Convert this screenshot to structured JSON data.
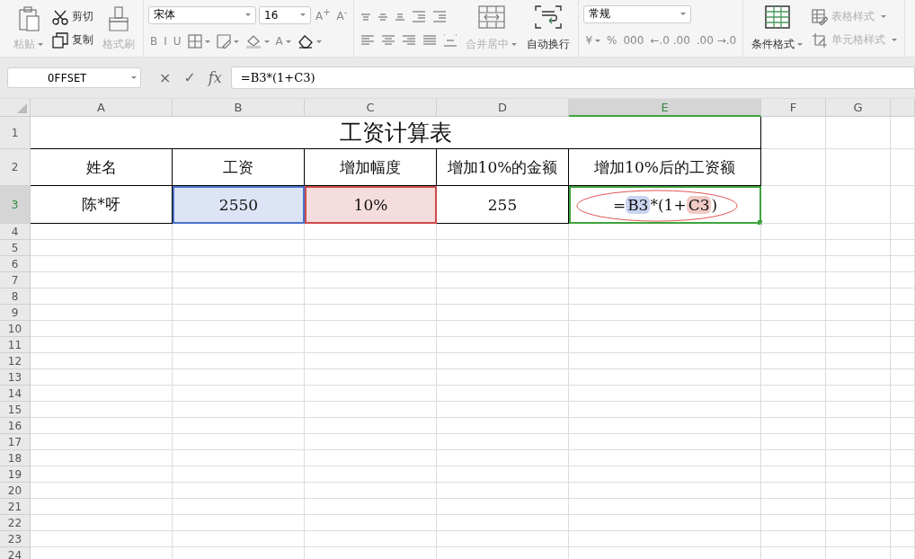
{
  "ribbon": {
    "groups": [
      {
        "kind": "row",
        "items": [
          {
            "kind": "big",
            "label": "粘贴",
            "disabled": true,
            "dropdown": true
          },
          {
            "kind": "col",
            "items": [
              {
                "kind": "small",
                "label": "剪切",
                "disabled": false
              },
              {
                "kind": "small",
                "label": "复制",
                "disabled": false
              }
            ]
          },
          {
            "kind": "big",
            "label": "格式刷",
            "disabled": true,
            "dropdown": false
          }
        ]
      },
      {
        "kind": "col",
        "items": [
          {
            "kind": "row",
            "items": [
              {
                "kind": "select",
                "value": "宋体"
              },
              {
                "kind": "select",
                "value": "16"
              },
              {
                "kind": "char",
                "label": "A$^{+}$",
                "dropdown": false
              },
              {
                "kind": "char",
                "label": "A$^{-}$",
                "dropdown": false
              }
            ]
          },
          {
            "kind": "row",
            "items": [
              {
                "kind": "char",
                "label": "B",
                "dropdown": false
              },
              {
                "kind": "char",
                "label": "I",
                "dropdown": false
              },
              {
                "kind": "char",
                "label": "U",
                "dropdown": false
              },
              {
                "kind": "icon",
                "dropdown": true
              },
              {
                "kind": "icon",
                "dropdown": true
              },
              {
                "kind": "icon",
                "dropdown": true
              },
              {
                "kind": "char",
                "label": "A",
                "dropdown": true
              },
              {
                "kind": "icon",
                "dropdown": true
              }
            ]
          }
        ]
      },
      {
        "kind": "row",
        "items": [
          {
            "kind": "col",
            "items": [
              {
                "kind": "row",
                "items": [
                  {
                    "kind": "icon",
                    "dropdown": false
                  },
                  {
                    "kind": "icon",
                    "dropdown": false
                  },
                  {
                    "kind": "icon",
                    "dropdown": false
                  },
                  {
                    "kind": "icon",
                    "dropdown": false
                  },
                  {
                    "kind": "icon",
                    "dropdown": false
                  }
                ]
              },
              {
                "kind": "row",
                "items": [
                  {
                    "kind": "icon",
                    "dropdown": false
                  },
                  {
                    "kind": "icon",
                    "dropdown": false
                  },
                  {
                    "kind": "icon",
                    "dropdown": false
                  },
                  {
                    "kind": "icon",
                    "dropdown": false
                  },
                  {
                    "kind": "icon",
                    "dropdown": false
                  }
                ]
              }
            ]
          },
          {
            "kind": "big",
            "label": "合并居中",
            "disabled": true,
            "dropdown": true
          },
          {
            "kind": "big",
            "label": "自动换行",
            "disabled": false,
            "dropdown": false
          }
        ]
      },
      {
        "kind": "col",
        "items": [
          {
            "kind": "row",
            "items": [
              {
                "kind": "select",
                "value": "常规"
              }
            ]
          },
          {
            "kind": "row",
            "items": [
              {
                "kind": "char",
                "label": "¥",
                "dropdown": true
              },
              {
                "kind": "char",
                "label": "%",
                "dropdown": false
              },
              {
                "kind": "char",
                "label": "000",
                "dropdown": false
              },
              {
                "kind": "char",
                "label": "←.0 .00",
                "dropdown": false
              },
              {
                "kind": "char",
                "label": ".00 →.0",
                "dropdown": false
              }
            ]
          }
        ]
      },
      {
        "kind": "row",
        "items": [
          {
            "kind": "big",
            "label": "条件格式",
            "disabled": false,
            "dropdown": true
          },
          {
            "kind": "col",
            "items": [
              {
                "kind": "small",
                "label": "表格样式",
                "disabled": true,
                "dropdown": true
              },
              {
                "kind": "small",
                "label": "单元格样式",
                "disabled": true,
                "dropdown": true
              }
            ]
          }
        ]
      }
    ]
  },
  "formula_bar": {
    "name_box": "OFFSET",
    "cancel": "×",
    "confirm": "✓",
    "fx": "fx",
    "formula": "=B3*(1+C3)"
  },
  "sheet": {
    "columns": [
      {
        "label": "A",
        "selected": false
      },
      {
        "label": "B",
        "selected": false
      },
      {
        "label": "C",
        "selected": false
      },
      {
        "label": "D",
        "selected": false
      },
      {
        "label": "E",
        "selected": true
      },
      {
        "label": "F",
        "selected": false
      },
      {
        "label": "G",
        "selected": false
      }
    ],
    "rows": [
      {
        "label": "1",
        "selected": false,
        "cells": [
          {
            "text": "工资计算表",
            "merged": true
          }
        ]
      },
      {
        "label": "2",
        "selected": false,
        "cells": [
          {
            "text": "姓名"
          },
          {
            "text": "工资"
          },
          {
            "text": "增加幅度"
          },
          {
            "text": "增加10%的金额"
          },
          {
            "text": "增加10%后的工资额"
          }
        ]
      },
      {
        "label": "3",
        "selected": true,
        "cells": [
          {
            "text": "陈*呀"
          },
          {
            "text": "2550",
            "color": "#4a72cc"
          },
          {
            "text": "10%",
            "color": "#cc4a4a"
          },
          {
            "text": "255"
          },
          {
            "selected": true,
            "parts": [
              {
                "kind": "plain",
                "text": "="
              },
              {
                "kind": "ref",
                "text": "B3",
                "color": "#c9d4f0"
              },
              {
                "kind": "plain",
                "text": "*(1+"
              },
              {
                "kind": "ref",
                "text": "C3",
                "color": "#f0c9c5"
              },
              {
                "kind": "plain",
                "text": ")"
              }
            ]
          }
        ]
      },
      {
        "label": "4",
        "selected": false
      },
      {
        "label": "5",
        "selected": false
      },
      {
        "label": "6",
        "selected": false
      },
      {
        "label": "7",
        "selected": false
      },
      {
        "label": "8",
        "selected": false
      },
      {
        "label": "9",
        "selected": false
      },
      {
        "label": "10",
        "selected": false
      },
      {
        "label": "11",
        "selected": false
      },
      {
        "label": "12",
        "selected": false
      },
      {
        "label": "13",
        "selected": false
      },
      {
        "label": "14",
        "selected": false
      },
      {
        "label": "15",
        "selected": false
      },
      {
        "label": "16",
        "selected": false
      },
      {
        "label": "17",
        "selected": false
      },
      {
        "label": "18",
        "selected": false
      },
      {
        "label": "19",
        "selected": false
      },
      {
        "label": "20",
        "selected": false
      },
      {
        "label": "21",
        "selected": false
      },
      {
        "label": "22",
        "selected": false
      },
      {
        "label": "23",
        "selected": false
      },
      {
        "label": "24",
        "selected": false
      }
    ]
  }
}
